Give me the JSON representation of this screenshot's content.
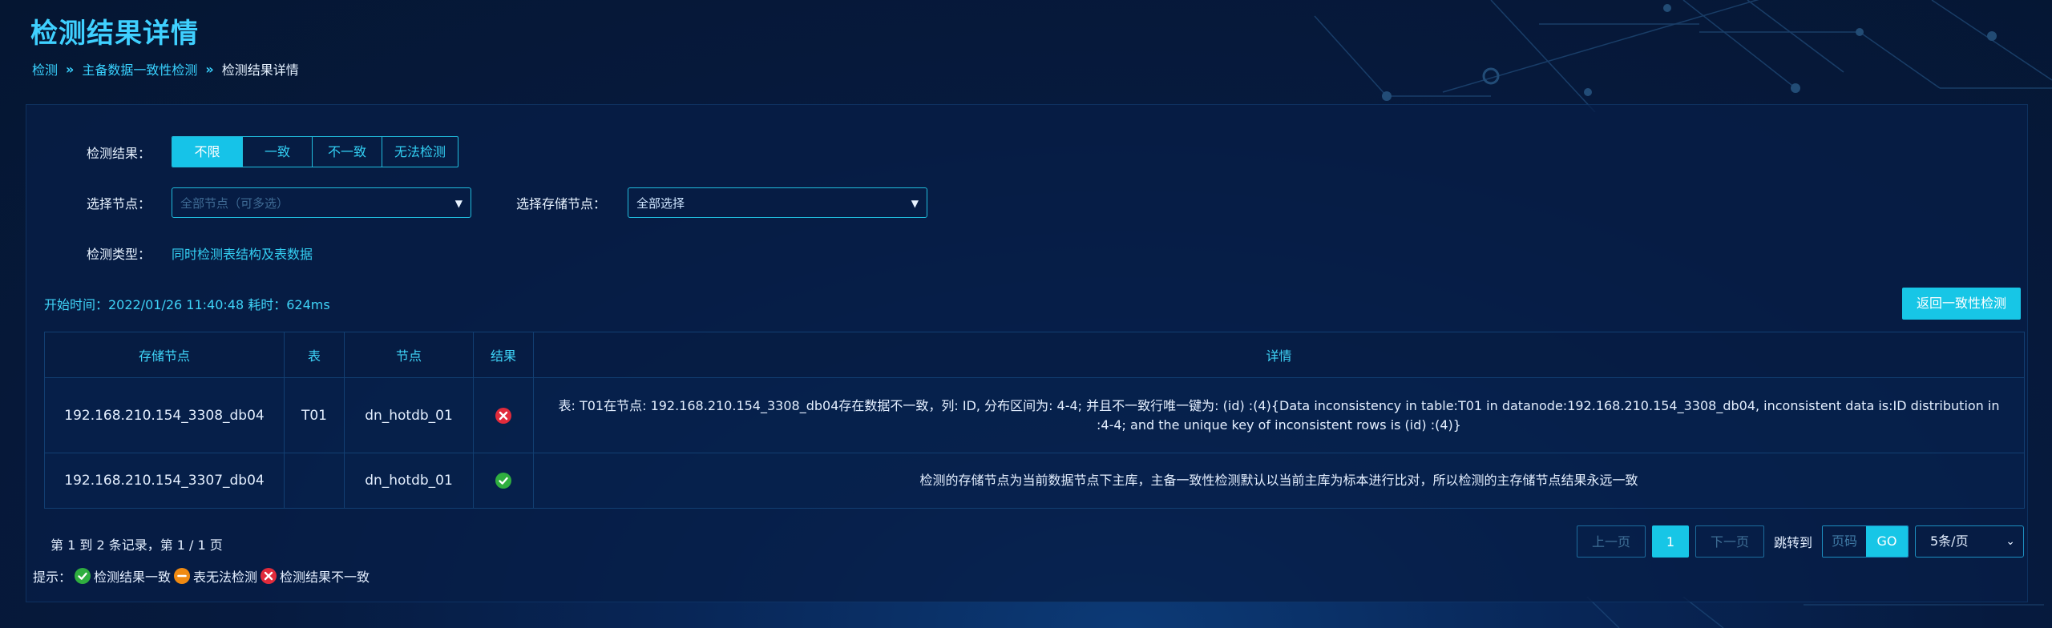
{
  "page_title": "检测结果详情",
  "breadcrumb": [
    "检测",
    "主备数据一致性检测",
    "检测结果详情"
  ],
  "filters": {
    "result_label": "检测结果：",
    "result_options": [
      "不限",
      "一致",
      "不一致",
      "无法检测"
    ],
    "result_selected": "不限",
    "node_label": "选择节点：",
    "node_placeholder": "全部节点（可多选）",
    "storage_node_label": "选择存储节点：",
    "storage_node_value": "全部选择",
    "type_label": "检测类型：",
    "type_value": "同时检测表结构及表数据"
  },
  "meta": "开始时间：2022/01/26 11:40:48 耗时：624ms",
  "back_button": "返回一致性检测",
  "table": {
    "headers": [
      "存储节点",
      "表",
      "节点",
      "结果",
      "详情"
    ],
    "rows": [
      {
        "storage_node": "192.168.210.154_3308_db04",
        "table": "T01",
        "node": "dn_hotdb_01",
        "result": "error-icon",
        "detail": "表: T01在节点: 192.168.210.154_3308_db04存在数据不一致，列: ID, 分布区间为: 4-4; 并且不一致行唯一键为: (id) :(4){Data inconsistency in table:T01 in datanode:192.168.210.154_3308_db04, inconsistent data is:ID distribution in :4-4; and the unique key of inconsistent rows is (id) :(4)}"
      },
      {
        "storage_node": "192.168.210.154_3307_db04",
        "table": "",
        "node": "dn_hotdb_01",
        "result": "check-icon",
        "detail": "检测的存储节点为当前数据节点下主库，主备一致性检测默认以当前主库为标本进行比对，所以检测的主存储节点结果永远一致"
      }
    ]
  },
  "summary": "第 1 到 2 条记录，第 1 / 1 页",
  "legend": {
    "prefix": "提示：",
    "ok": "检测结果一致",
    "warn": "表无法检测",
    "err": "检测结果不一致"
  },
  "pagination": {
    "prev": "上一页",
    "current": "1",
    "next": "下一页",
    "jump_label": "跳转到",
    "page_placeholder": "页码",
    "go": "GO",
    "page_size": "5条/页"
  },
  "colors": {
    "accent": "#17c6e6",
    "title": "#3fd0ff",
    "ok": "#2fae3f",
    "warn": "#f08a12",
    "error": "#e12b3b"
  }
}
